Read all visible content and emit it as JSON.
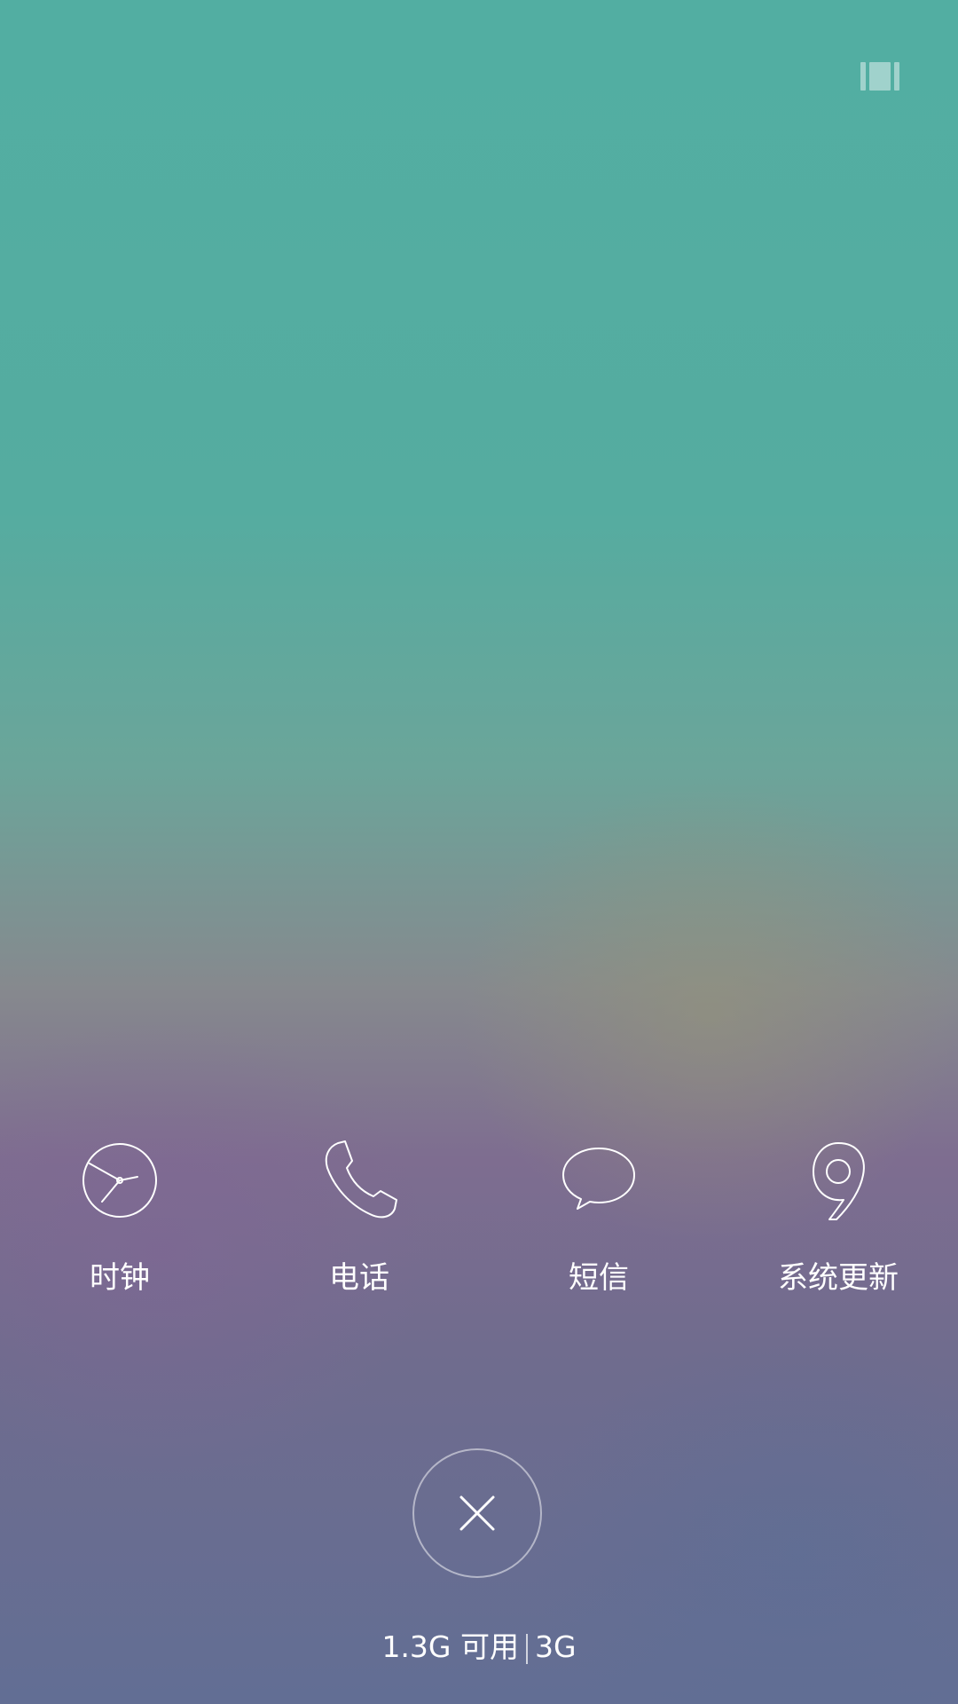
{
  "recent_apps": [
    {
      "label": "时钟",
      "icon": "clock-icon"
    },
    {
      "label": "电话",
      "icon": "phone-icon"
    },
    {
      "label": "短信",
      "icon": "message-icon"
    },
    {
      "label": "系统更新",
      "icon": "system-update-icon"
    }
  ],
  "clear_button": {
    "icon": "close-icon"
  },
  "memory": {
    "available": "1.3G 可用",
    "total": "3G"
  },
  "indicator": {
    "icon": "memory-indicator-icon"
  },
  "colors": {
    "top": "#52aea2",
    "middle": "#86898e",
    "bottom": "#626e94",
    "icon_stroke": "#ffffff"
  }
}
